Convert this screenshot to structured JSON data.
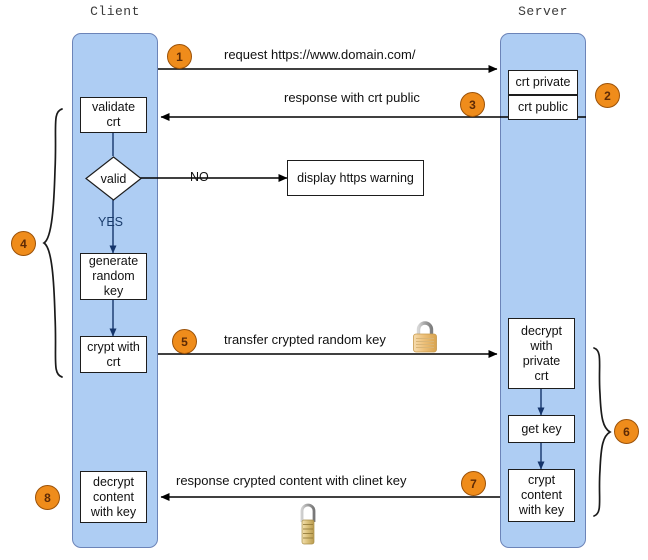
{
  "diagram": {
    "title_client": "Client",
    "title_server": "Server",
    "lanes": [
      {
        "name": "client",
        "label": "Client"
      },
      {
        "name": "server",
        "label": "Server"
      }
    ],
    "client_steps": [
      {
        "id": "validate-crt",
        "text": "validate\ncrt"
      },
      {
        "id": "valid-decision",
        "text": "valid"
      },
      {
        "id": "generate-random-key",
        "text": "generate\nrandom\nkey"
      },
      {
        "id": "crypt-with-crt",
        "text": "crypt with\ncrt"
      },
      {
        "id": "decrypt-content-with-key",
        "text": "decrypt\ncontent\nwith key"
      }
    ],
    "server_steps": [
      {
        "id": "crt-private",
        "text": "crt private"
      },
      {
        "id": "crt-public",
        "text": "crt public"
      },
      {
        "id": "decrypt-with-private-crt",
        "text": "decrypt\nwith\nprivate\ncrt"
      },
      {
        "id": "get-key",
        "text": "get key"
      },
      {
        "id": "crypt-content-with-key",
        "text": "crypt\ncontent\nwith key"
      }
    ],
    "external_steps": [
      {
        "id": "https-warning",
        "text": "display https warning"
      }
    ],
    "branch_labels": {
      "no": "NO",
      "yes": "YES"
    },
    "messages": [
      {
        "id": "request",
        "text": "request https://www.domain.com/"
      },
      {
        "id": "response-crt-public",
        "text": "response with crt public"
      },
      {
        "id": "transfer-key",
        "text": "transfer crypted random key"
      },
      {
        "id": "response-content",
        "text": "response crypted content with clinet key"
      }
    ],
    "badges": [
      {
        "id": "badge-1",
        "label": "1"
      },
      {
        "id": "badge-2",
        "label": "2"
      },
      {
        "id": "badge-3",
        "label": "3"
      },
      {
        "id": "badge-4",
        "label": "4"
      },
      {
        "id": "badge-5",
        "label": "5"
      },
      {
        "id": "badge-6",
        "label": "6"
      },
      {
        "id": "badge-7",
        "label": "7"
      },
      {
        "id": "badge-8",
        "label": "8"
      }
    ],
    "icons": [
      {
        "id": "padlock-closed",
        "name": "padlock-icon"
      },
      {
        "id": "combination-padlock",
        "name": "combination-padlock-icon"
      }
    ],
    "colors": {
      "lane_fill": "#aecdf3",
      "lane_stroke": "#6c84b8",
      "badge_fill": "#ef8c1b",
      "badge_stroke": "#9c5208",
      "box_fill": "#ffffff",
      "box_stroke": "#1d1d1d",
      "connector": "#15356b",
      "arrow": "#000000",
      "padlock_body": "#e8c07a",
      "padlock_shackle": "#9a9a9a",
      "background": "#ffffff"
    }
  }
}
